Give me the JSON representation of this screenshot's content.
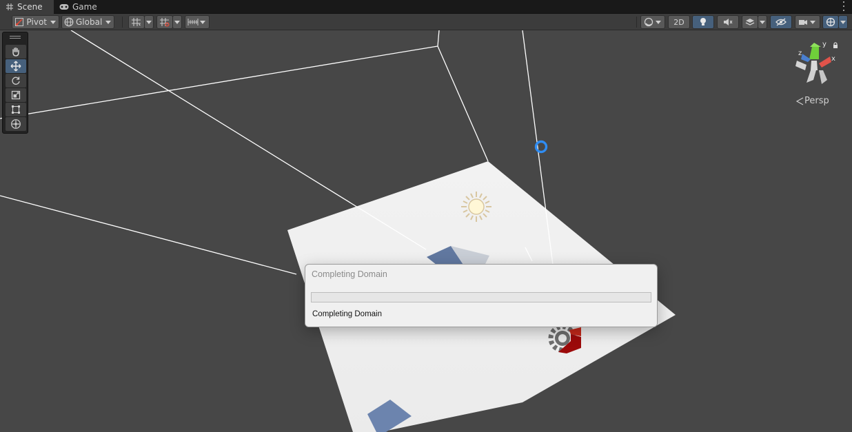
{
  "tabs": [
    {
      "label": "Scene",
      "icon": "grid-icon",
      "active": true
    },
    {
      "label": "Game",
      "icon": "gamepad-icon",
      "active": false
    }
  ],
  "toolbar": {
    "pivot_label": "Pivot",
    "global_label": "Global",
    "mode_2d_label": "2D"
  },
  "tools": [
    {
      "name": "hand-tool",
      "selected": false
    },
    {
      "name": "move-tool",
      "selected": true
    },
    {
      "name": "rotate-tool",
      "selected": false
    },
    {
      "name": "scale-tool",
      "selected": false
    },
    {
      "name": "rect-tool",
      "selected": false
    },
    {
      "name": "transform-tool",
      "selected": false
    }
  ],
  "gizmo": {
    "projection_label": "Persp",
    "axis_x": "x",
    "axis_y": "y",
    "axis_z": "z"
  },
  "dialog": {
    "title": "Completing Domain",
    "status": "Completing Domain",
    "progress": 0.0
  },
  "colors": {
    "selected_button": "#46607c",
    "scene_background": "#474747",
    "dialog_background": "#f0f0f0"
  }
}
